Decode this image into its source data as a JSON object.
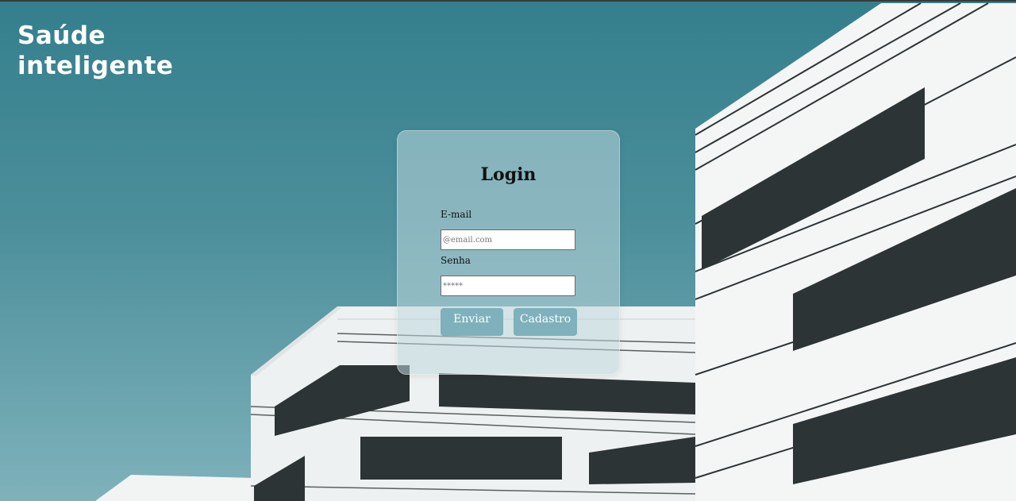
{
  "logo": {
    "line1": "Saúde",
    "line2": "inteligente"
  },
  "login": {
    "title": "Login",
    "email_label": "E-mail",
    "email_placeholder": "@email.com",
    "password_label": "Senha",
    "password_placeholder": "*****",
    "submit_label": "Enviar",
    "register_label": "Cadastro"
  },
  "colors": {
    "sky": "#3f8894",
    "card": "#bed7dc",
    "button": "#7eb1bb"
  }
}
